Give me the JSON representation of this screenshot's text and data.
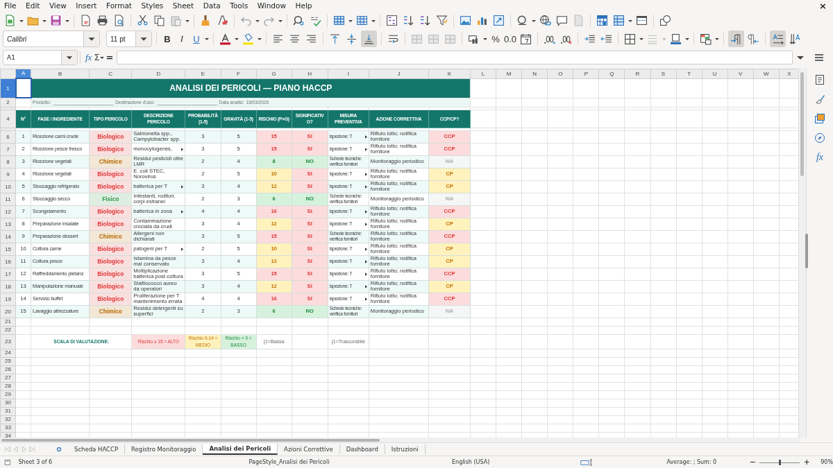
{
  "menu": [
    "File",
    "Edit",
    "View",
    "Insert",
    "Format",
    "Styles",
    "Sheet",
    "Data",
    "Tools",
    "Window",
    "Help"
  ],
  "close": "×",
  "toolbar": {
    "font": "Calibri",
    "size": "11 pt",
    "bold": "B",
    "italic": "I",
    "underline": "U",
    "percent": "%",
    "number": "0.0",
    "pressed": {
      "align_bottom": true,
      "left_to_right": true,
      "text_direction": true
    }
  },
  "formula_bar": {
    "cell": "A1",
    "function_wizard": "fx",
    "sum": "Σ",
    "equals": "="
  },
  "columns": [
    {
      "label": "A",
      "selected": true
    },
    {
      "label": "B",
      "selected": false
    },
    {
      "label": "C",
      "selected": false
    },
    {
      "label": "D",
      "selected": false
    },
    {
      "label": "E",
      "selected": false
    },
    {
      "label": "F",
      "selected": false
    },
    {
      "label": "G",
      "selected": false
    },
    {
      "label": "H",
      "selected": false
    },
    {
      "label": "I",
      "selected": false
    },
    {
      "label": "J",
      "selected": false
    },
    {
      "label": "K",
      "selected": false
    },
    {
      "label": "L",
      "selected": false
    },
    {
      "label": "M",
      "selected": false
    },
    {
      "label": "N",
      "selected": false
    },
    {
      "label": "O",
      "selected": false
    },
    {
      "label": "P",
      "selected": false
    },
    {
      "label": "Q",
      "selected": false
    },
    {
      "label": "R",
      "selected": false
    },
    {
      "label": "S",
      "selected": false
    },
    {
      "label": "T",
      "selected": false
    },
    {
      "label": "U",
      "selected": false
    },
    {
      "label": "V",
      "selected": false
    },
    {
      "label": "W",
      "selected": false
    },
    {
      "label": "X",
      "selected": false
    }
  ],
  "title_row": {
    "number": "1",
    "selected": true,
    "text": "ANALISI DEI PERICOLI — PIANO HACCP"
  },
  "info_row": {
    "number": "2",
    "product_label": "Prodotto:",
    "product_blank": "______________________",
    "destination_label": "Destinazione d'uso:",
    "destination_blank": "______________________",
    "date_label": "Data analisi:",
    "date": "16/03/2026"
  },
  "header_row": {
    "number": "4",
    "cells": [
      "N°",
      "FASE / INGREDIENTE",
      "TIPO PERICOLO",
      "DESCRIZIONE PERICOLO",
      "PROBABILITÀ (1-5)",
      "GRAVITÀ (1-5)",
      "RISCHIO (P×G)",
      "SIGNIFICATIVO?",
      "MISURA PREVENTIVA",
      "AZIONE CORRETTIVA",
      "CCP/CP?"
    ]
  },
  "rows": [
    {
      "number": "6",
      "kind": "high",
      "n": "1",
      "phase": "Ricezione carni crude",
      "hazard": {
        "text": "Biologico",
        "color": "#e03535"
      },
      "description": "Salmonella spp., Campylobacter spp.",
      "description_clipped": false,
      "probability": "3",
      "severity": "5",
      "risk_value": "15",
      "significant": "SI",
      "measure": "ispezione: T",
      "measure_clipped": true,
      "action": "Rifiuto lotto; notifica fornitore",
      "ccp": "CCP"
    },
    {
      "number": "7",
      "kind": "high",
      "n": "2",
      "phase": "Ricezione pesce fresco",
      "hazard": {
        "text": "Biologico",
        "color": "#e03535"
      },
      "description": "monocytogenes,",
      "description_clipped": true,
      "probability": "3",
      "severity": "5",
      "risk_value": "15",
      "significant": "SI",
      "measure": "ispezione: T",
      "measure_clipped": true,
      "action": "Rifiuto lotto; notifica fornitore",
      "ccp": "CCP"
    },
    {
      "number": "8",
      "kind": "low",
      "n": "3",
      "phase": "Ricezione vegetali",
      "hazard": {
        "text": "Chimico",
        "color": "#b56a00"
      },
      "description": "Residui pesticidi oltre LMR",
      "description_clipped": false,
      "probability": "2",
      "severity": "4",
      "risk_value": "8",
      "significant": "NO",
      "measure": "Schede tecniche: verifica fornitori",
      "measure_clipped": false,
      "action": "Monitoraggio periodico",
      "ccp": "N/A"
    },
    {
      "number": "9",
      "kind": "medium",
      "n": "4",
      "phase": "Ricezione vegetali",
      "hazard": {
        "text": "Biologico",
        "color": "#e03535"
      },
      "description": "E. coli STEC, Norovirus",
      "description_clipped": false,
      "probability": "2",
      "severity": "5",
      "risk_value": "10",
      "significant": "SI",
      "measure": "ispezione: T",
      "measure_clipped": true,
      "action": "Rifiuto lotto; notifica fornitore",
      "ccp": "CP"
    },
    {
      "number": "10",
      "kind": "medium",
      "n": "5",
      "phase": "Stoccaggio refrigerato",
      "hazard": {
        "text": "Biologico",
        "color": "#e03535"
      },
      "description": "batterica per T",
      "description_clipped": true,
      "probability": "3",
      "severity": "4",
      "risk_value": "12",
      "significant": "SI",
      "measure": "ispezione: T",
      "measure_clipped": true,
      "action": "Rifiuto lotto; notifica fornitore",
      "ccp": "CP"
    },
    {
      "number": "11",
      "kind": "low",
      "n": "6",
      "phase": "Stoccaggio secco",
      "hazard": {
        "text": "Fisico",
        "color": "#2e9a4a"
      },
      "description": "Infestanti, roditori, corpi estranei",
      "description_clipped": false,
      "probability": "2",
      "severity": "3",
      "risk_value": "6",
      "significant": "NO",
      "measure": "Schede tecniche: verifica fornitori",
      "measure_clipped": false,
      "action": "Monitoraggio periodico",
      "ccp": "N/A"
    },
    {
      "number": "12",
      "kind": "high",
      "n": "7",
      "phase": "Scongelamento",
      "hazard": {
        "text": "Biologico",
        "color": "#e03535"
      },
      "description": "batterica in zona",
      "description_clipped": true,
      "probability": "4",
      "severity": "4",
      "risk_value": "16",
      "significant": "SI",
      "measure": "ispezione: T",
      "measure_clipped": true,
      "action": "Rifiuto lotto; notifica fornitore",
      "ccp": "CCP"
    },
    {
      "number": "13",
      "kind": "medium",
      "n": "8",
      "phase": "Preparazione insalate",
      "hazard": {
        "text": "Biologico",
        "color": "#e03535"
      },
      "description": "Contaminazione crociata da crudi",
      "description_clipped": false,
      "probability": "3",
      "severity": "4",
      "risk_value": "12",
      "significant": "SI",
      "measure": "ispezione: T",
      "measure_clipped": true,
      "action": "Rifiuto lotto; notifica fornitore",
      "ccp": "CP"
    },
    {
      "number": "14",
      "kind": "high",
      "n": "9",
      "phase": "Preparazione dessert",
      "hazard": {
        "text": "Chimico",
        "color": "#b56a00"
      },
      "description": "Allergeni non dichiarati",
      "description_clipped": false,
      "probability": "3",
      "severity": "5",
      "risk_value": "15",
      "significant": "SI",
      "measure": "Schede tecniche: verifica fornitori",
      "measure_clipped": false,
      "action": "Rifiuto lotto; notifica fornitore",
      "ccp": "CCP"
    },
    {
      "number": "15",
      "kind": "medium",
      "n": "10",
      "phase": "Cottura carne",
      "hazard": {
        "text": "Biologico",
        "color": "#e03535"
      },
      "description": "patogeni per T",
      "description_clipped": true,
      "probability": "2",
      "severity": "5",
      "risk_value": "10",
      "significant": "SI",
      "measure": "ispezione: T",
      "measure_clipped": true,
      "action": "Rifiuto lotto; notifica fornitore",
      "ccp": "CP"
    },
    {
      "number": "16",
      "kind": "medium",
      "n": "11",
      "phase": "Cottura pesce",
      "hazard": {
        "text": "Biologico",
        "color": "#e03535"
      },
      "description": "Istamina da pesce mal conservato",
      "description_clipped": false,
      "probability": "3",
      "severity": "4",
      "risk_value": "12",
      "significant": "SI",
      "measure": "ispezione: T",
      "measure_clipped": true,
      "action": "Rifiuto lotto; notifica fornitore",
      "ccp": "CP"
    },
    {
      "number": "17",
      "kind": "high",
      "n": "12",
      "phase": "Raffreddamento pietanz",
      "hazard": {
        "text": "Biologico",
        "color": "#e03535"
      },
      "description": "Moltiplicazione batterica post-cottura",
      "description_clipped": false,
      "probability": "3",
      "severity": "5",
      "risk_value": "15",
      "significant": "SI",
      "measure": "ispezione: T",
      "measure_clipped": true,
      "action": "Rifiuto lotto; notifica fornitore",
      "ccp": "CCP"
    },
    {
      "number": "18",
      "kind": "medium",
      "n": "13",
      "phase": "Manipolazione manuale",
      "hazard": {
        "text": "Biologico",
        "color": "#e03535"
      },
      "description": "Stafilococco aureo da operatori",
      "description_clipped": false,
      "probability": "3",
      "severity": "4",
      "risk_value": "12",
      "significant": "SI",
      "measure": "ispezione: T",
      "measure_clipped": true,
      "action": "Rifiuto lotto; notifica fornitore",
      "ccp": "CP"
    },
    {
      "number": "19",
      "kind": "high",
      "n": "14",
      "phase": "Servizio buffet",
      "hazard": {
        "text": "Biologico",
        "color": "#e03535"
      },
      "description": "Proliferazione per T mantenimento errata",
      "description_clipped": false,
      "probability": "4",
      "severity": "4",
      "risk_value": "16",
      "significant": "SI",
      "measure": "ispezione: T",
      "measure_clipped": true,
      "action": "Rifiuto lotto; notifica fornitore",
      "ccp": "CCP"
    },
    {
      "number": "20",
      "kind": "low",
      "n": "15",
      "phase": "Lavaggio attrezzature",
      "hazard": {
        "text": "Chimico",
        "color": "#b56a00"
      },
      "description": "Residui detergenti su superfici",
      "description_clipped": false,
      "probability": "2",
      "severity": "3",
      "risk_value": "6",
      "significant": "NO",
      "measure": "Schede tecniche: verifica fornitori",
      "measure_clipped": false,
      "action": "Monitoraggio periodico",
      "ccp": "N/A"
    }
  ],
  "blank_rows_before": [
    "21",
    "22"
  ],
  "scale_row": {
    "number": "23",
    "label": "SCALA DI VALUTAZIONE:",
    "levels": [
      {
        "text": "Rischio ≥ 15 = ALTO",
        "kind": "high"
      },
      {
        "text": "Rischio 9-14 = MEDIO",
        "kind": "medium"
      },
      {
        "text": "Rischio < 9 = BASSO",
        "kind": "low"
      }
    ],
    "probability_note": "(1=Bassa",
    "severity_note": "(1=Trascurabile"
  },
  "blank_rows_after": [
    "24",
    "25",
    "26",
    "27",
    "28",
    "29",
    "30",
    "31",
    "32",
    "33",
    "34"
  ],
  "sheet_tabs": [
    {
      "label": "Scheda HACCP",
      "selected": false
    },
    {
      "label": "Registro Monitoraggio",
      "selected": false
    },
    {
      "label": "Analisi dei Pericoli",
      "selected": true
    },
    {
      "label": "Azioni Correttive",
      "selected": false
    },
    {
      "label": "Dashboard",
      "selected": false
    },
    {
      "label": "Istruzioni",
      "selected": false
    }
  ],
  "sidebar": {
    "functions": "fx"
  },
  "status_bar": {
    "sheet": "Sheet 3 of 6",
    "page_style": "PageStyle_Analisi dei Pericoli",
    "language": "English (USA)",
    "summary": "Average: ; Sum: 0",
    "zoom": {
      "level": 0.5,
      "reading": "90%"
    }
  }
}
